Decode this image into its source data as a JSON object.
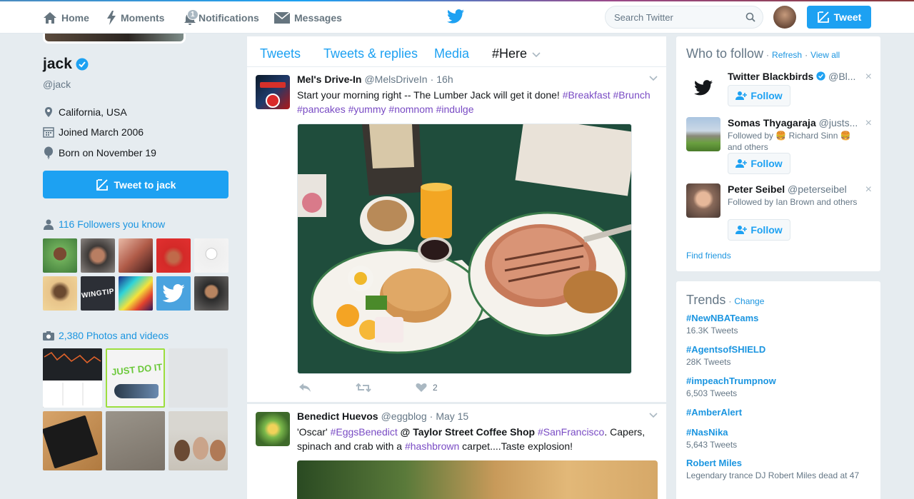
{
  "nav": {
    "home": "Home",
    "moments": "Moments",
    "notifications": "Notifications",
    "notifications_count": "1",
    "messages": "Messages",
    "search_placeholder": "Search Twitter",
    "tweet_button": "Tweet"
  },
  "profile": {
    "name": "jack",
    "handle": "@jack",
    "location": "California, USA",
    "joined": "Joined March 2006",
    "born": "Born on November 19",
    "tweet_to_button": "Tweet to jack",
    "followers_you_know": "116 Followers you know",
    "photos_videos": "2,380 Photos and videos"
  },
  "timeline": {
    "tabs": [
      "Tweets",
      "Tweets & replies",
      "Media",
      "#Here"
    ],
    "tweets": [
      {
        "name": "Mel's Drive-In",
        "handle": "@MelsDriveIn",
        "time": "16h",
        "text_plain": "Start your morning right -- The Lumber Jack will get it done!",
        "hashtags_line1": [
          "#Breakfast",
          "#Brunch"
        ],
        "hashtags_line2": [
          "#pancakes",
          "#yummy",
          "#nomnom",
          "#indulge"
        ],
        "likes": "2"
      },
      {
        "name": "Benedict Huevos",
        "handle": "@eggblog",
        "time": "May 15",
        "quote": "'Oscar'",
        "hashtag1": "#EggsBenedict",
        "place": "@ Taylor Street Coffee Shop",
        "hashtag2": "#SanFrancisco",
        "text_after": ". Capers,",
        "line2_before": "spinach and crab with a",
        "hashtag3": "#hashbrown",
        "line2_after": "carpet....Taste explosion!"
      }
    ]
  },
  "who_to_follow": {
    "title": "Who to follow",
    "refresh": "Refresh",
    "view_all": "View all",
    "follow_label": "Follow",
    "find_friends": "Find friends",
    "items": [
      {
        "name": "Twitter Blackbirds",
        "handle": "@Bl...",
        "sub": ""
      },
      {
        "name": "Somas Thyagaraja",
        "handle": "@justs...",
        "sub_prefix": "Followed by",
        "sub_name": "Richard Sinn",
        "sub_suffix": "and others"
      },
      {
        "name": "Peter Seibel",
        "handle": "@peterseibel",
        "sub": "Followed by Ian Brown and others"
      }
    ]
  },
  "trends": {
    "title": "Trends",
    "change": "Change",
    "items": [
      {
        "name": "#NewNBATeams",
        "count": "16.3K Tweets"
      },
      {
        "name": "#AgentsofSHIELD",
        "count": "28K Tweets"
      },
      {
        "name": "#impeachTrumpnow",
        "count": "6,503 Tweets"
      },
      {
        "name": "#AmberAlert",
        "count": ""
      },
      {
        "name": "#NasNika",
        "count": "5,643 Tweets"
      },
      {
        "name": "Robert Miles",
        "count": "Legendary trance DJ Robert Miles dead at 47"
      }
    ]
  },
  "colors": {
    "accent": "#1da1f2",
    "link": "#1b95e0",
    "hashtag": "#794bc4",
    "background": "#e6ecf0"
  }
}
